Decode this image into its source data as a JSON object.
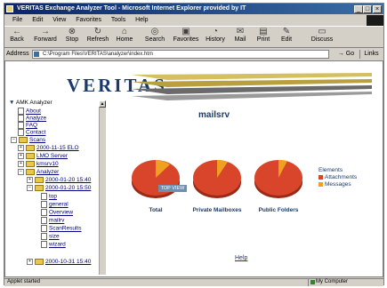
{
  "window": {
    "title": "VERITAS Exchange Analyzer Tool - Microsoft Internet Explorer provided by IT",
    "controls": [
      "minimize",
      "maximize",
      "close"
    ]
  },
  "menu": [
    "File",
    "Edit",
    "View",
    "Favorites",
    "Tools",
    "Help"
  ],
  "toolbar": [
    {
      "label": "Back",
      "icon": "back-arrow-icon"
    },
    {
      "label": "Forward",
      "icon": "forward-arrow-icon"
    },
    {
      "label": "Stop",
      "icon": "stop-icon"
    },
    {
      "label": "Refresh",
      "icon": "refresh-icon"
    },
    {
      "label": "Home",
      "icon": "home-icon"
    },
    {
      "label": "Search",
      "icon": "search-icon"
    },
    {
      "label": "Favorites",
      "icon": "favorites-icon"
    },
    {
      "label": "History",
      "icon": "history-icon"
    },
    {
      "label": "Mail",
      "icon": "mail-icon"
    },
    {
      "label": "Print",
      "icon": "print-icon"
    },
    {
      "label": "Edit",
      "icon": "edit-icon"
    },
    {
      "label": "Discuss",
      "icon": "discuss-icon"
    }
  ],
  "address": {
    "label": "Address",
    "url": "C:\\Program Files\\VERITAS\\analyzer\\index.htm",
    "go": "Go",
    "links": "Links"
  },
  "logo": {
    "text": "VERITAS"
  },
  "tree": {
    "root": "AMK Analyzer",
    "items": [
      "About",
      "Analyze",
      "FAQ",
      "Contact"
    ],
    "scans_label": "Scans",
    "scans": [
      "2000-11-15 ELO",
      "LMO Server",
      "kmsrv10",
      "Analyzer"
    ],
    "runs": [
      "2000-01-20 15:40",
      "2000-01-20 15:50"
    ],
    "run_items": [
      "top",
      "general",
      "Overview",
      "mailrv",
      "ScanResults",
      "size",
      "wizard"
    ],
    "last_run": "2000-10-31 15:40"
  },
  "main": {
    "server_title": "mailsrv",
    "tooltip": "TOP VIEW",
    "pies": [
      {
        "label": "Total"
      },
      {
        "label": "Private Mailboxes"
      },
      {
        "label": "Public Folders"
      }
    ],
    "legend_title": "Elements",
    "legend": [
      {
        "label": "Attachments",
        "color": "#d9452a"
      },
      {
        "label": "Messages",
        "color": "#f0a020"
      }
    ],
    "help": "Help"
  },
  "status": {
    "left": "Applet started",
    "zone": "My Computer"
  },
  "colors": {
    "pie_main": "#d9452a",
    "pie_slice": "#f0a020",
    "brand": "#1b3a6b"
  }
}
